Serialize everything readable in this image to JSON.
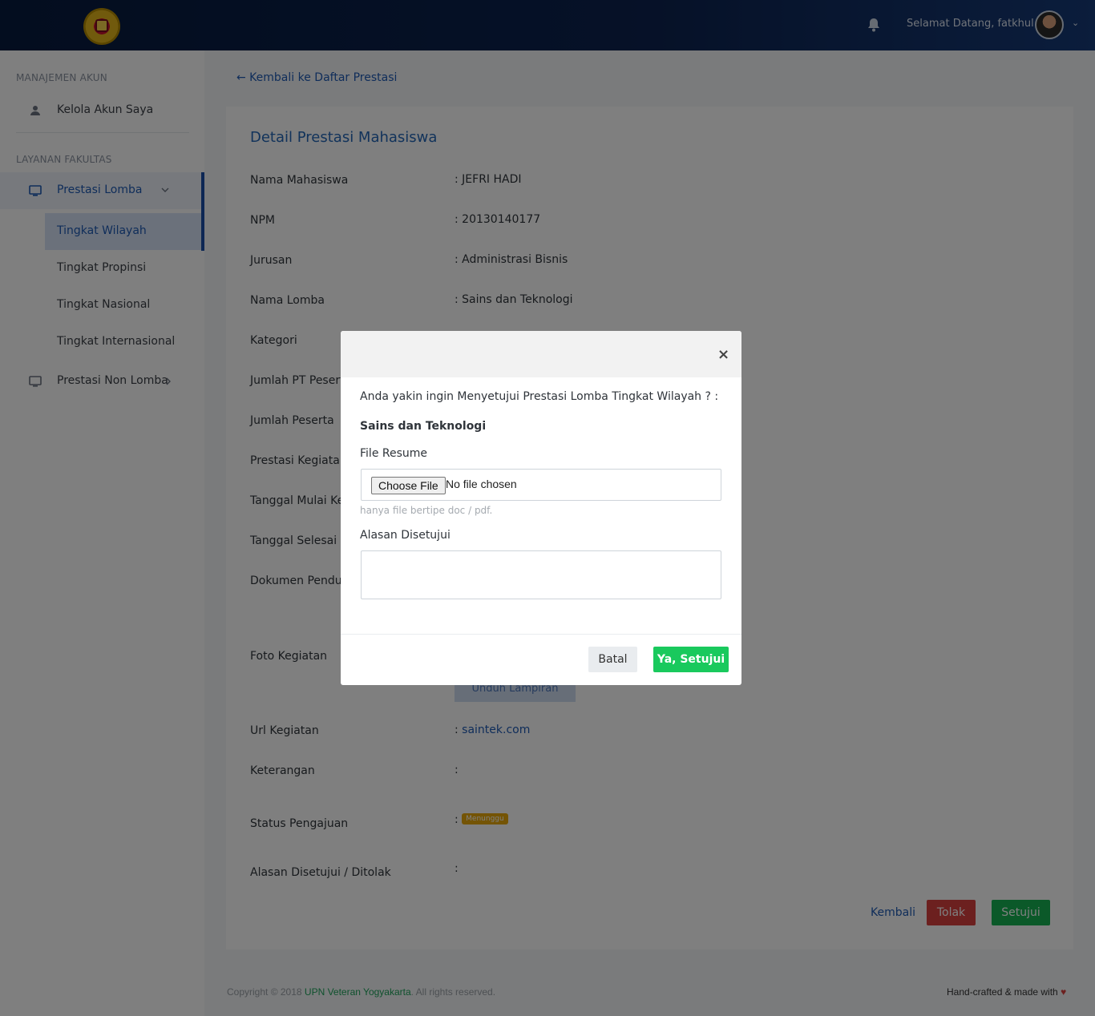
{
  "header": {
    "welcome_text": "Selamat Datang, fatkhul",
    "icons": {
      "logo": "university-logo",
      "bell": "bell-icon",
      "avatar": "user-avatar",
      "caret": "chevron-down-icon"
    }
  },
  "sidebar": {
    "section_account": "MANAJEMEN AKUN",
    "account_item": "Kelola Akun Saya",
    "section_faculty": "LAYANAN FAKULTAS",
    "group_lomba": "Prestasi Lomba",
    "sub_items": [
      "Tingkat Wilayah",
      "Tingkat Propinsi",
      "Tingkat Nasional",
      "Tingkat Internasional"
    ],
    "group_non_lomba": "Prestasi Non Lomba"
  },
  "main": {
    "back_link": "← Kembali ke Daftar Prestasi",
    "title": "Detail Prestasi Mahasiswa",
    "fields": [
      {
        "label": "Nama Mahasiswa",
        "value": ": JEFRI HADI"
      },
      {
        "label": "NPM",
        "value": ": 20130140177"
      },
      {
        "label": "Jurusan",
        "value": ": Administrasi Bisnis"
      },
      {
        "label": "Nama Lomba",
        "value": ": Sains dan Teknologi"
      },
      {
        "label": "Kategori",
        "value": ""
      },
      {
        "label": "Jumlah PT Peserta",
        "value": ""
      },
      {
        "label": "Jumlah Peserta",
        "value": ""
      },
      {
        "label": "Prestasi Kegiatan",
        "value": ""
      },
      {
        "label": "Tanggal Mulai Kegiatan",
        "value": ""
      },
      {
        "label": "Tanggal Selesai Kegiatan",
        "value": ""
      },
      {
        "label": "Dokumen Pendukung",
        "value": ""
      },
      {
        "label": "Foto Kegiatan",
        "value": ""
      },
      {
        "label": "Url Kegiatan",
        "value": ": ",
        "link": "saintek.com"
      },
      {
        "label": "Keterangan",
        "value": ":"
      },
      {
        "label": "Status Pengajuan",
        "value": ":",
        "badge": "Menunggu"
      },
      {
        "label": "Alasan Disetujui / Ditolak",
        "value": ":"
      }
    ],
    "upload_button": "Unduh Lampiran",
    "actions": {
      "back": "Kembali",
      "reject": "Tolak",
      "approve": "Setujui"
    }
  },
  "footer": {
    "copyright_prefix": "Copyright © 2018 ",
    "copyright_link": "UPN Veteran Yogyakarta",
    "copyright_suffix": ". All rights reserved.",
    "credit": "Hand-crafted & made with "
  },
  "modal": {
    "close": "×",
    "question": "Anda yakin ingin Menyetujui Prestasi Lomba Tingkat Wilayah ? :",
    "subject": "Sains dan Teknologi",
    "file_label": "File Resume",
    "file_button": "Choose File",
    "file_status": "No file chosen",
    "file_hint": "hanya file bertipe doc / pdf.",
    "reason_label": "Alasan Disetujui",
    "cancel": "Batal",
    "confirm": "Ya, Setujui"
  },
  "colors": {
    "primary": "#1f5bb5",
    "success": "#17b253",
    "danger": "#d9413f",
    "warning": "#e8a90b"
  }
}
